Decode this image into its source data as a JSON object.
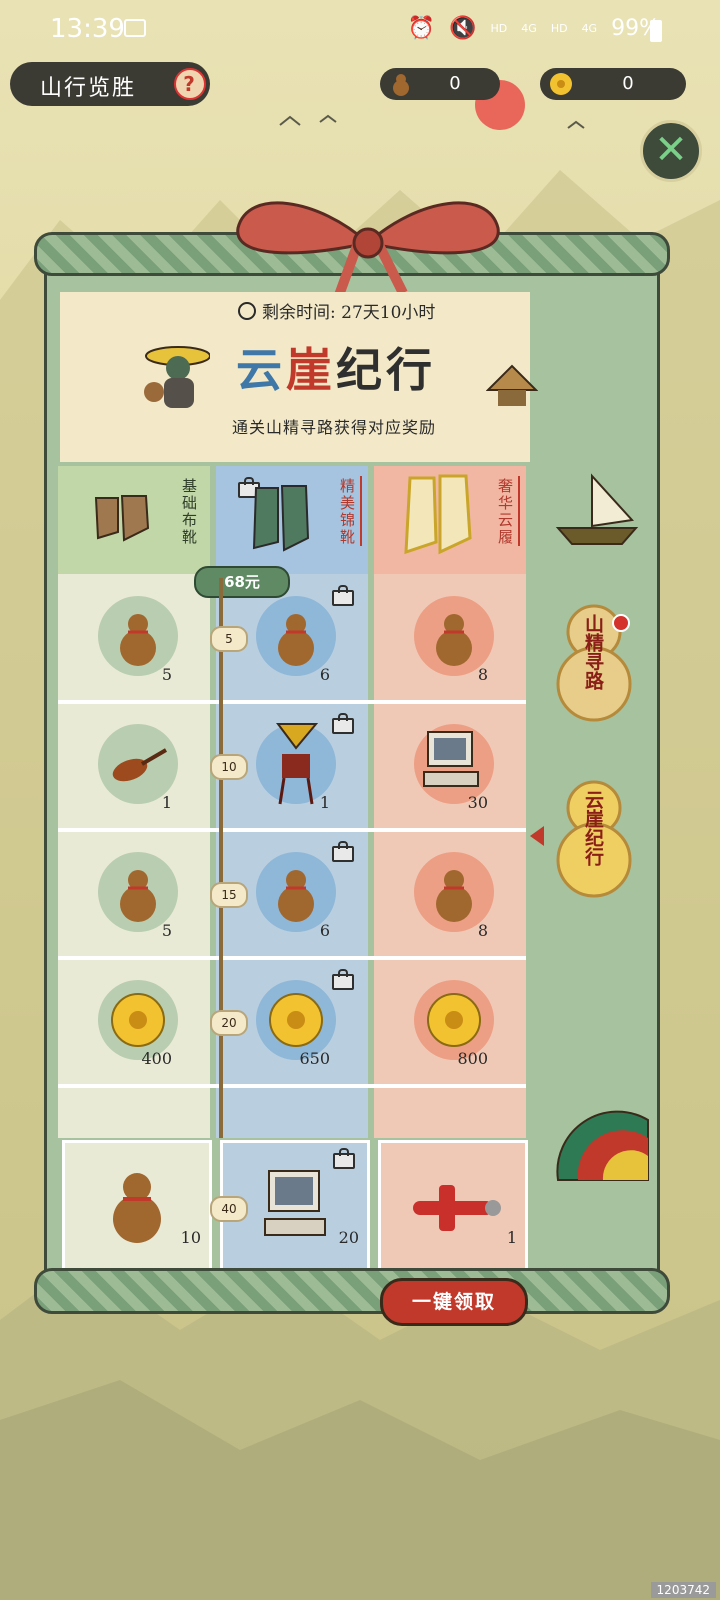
{
  "status_bar": {
    "time": "13:39",
    "hd1": "HD",
    "net1": "4G",
    "hd2": "HD",
    "net2": "4G",
    "battery": "99%"
  },
  "top_bar": {
    "title": "山行览胜",
    "help": "?",
    "gourd_count": "0",
    "flower_count": "0",
    "close": "✕"
  },
  "event": {
    "timer_label": "剩余时间: 27天10小时",
    "title_chars": [
      "云",
      "崖",
      "纪行"
    ],
    "subtitle": "通关山精寻路获得对应奖励"
  },
  "tiers": [
    {
      "name": "基础布靴"
    },
    {
      "name": "精美锦靴",
      "price": "68元"
    },
    {
      "name": "奢华云履"
    }
  ],
  "rows": [
    {
      "level": "5",
      "rewards": [
        {
          "icon": "gourd-icon",
          "qty": "5"
        },
        {
          "icon": "gourd-icon",
          "qty": "6"
        },
        {
          "icon": "gourd-icon",
          "qty": "8"
        }
      ]
    },
    {
      "level": "10",
      "rewards": [
        {
          "icon": "violin-icon",
          "qty": "1"
        },
        {
          "icon": "gramophone-icon",
          "qty": "1"
        },
        {
          "icon": "computer-icon",
          "qty": "30"
        }
      ]
    },
    {
      "level": "15",
      "rewards": [
        {
          "icon": "gourd-icon",
          "qty": "5"
        },
        {
          "icon": "gourd-icon",
          "qty": "6"
        },
        {
          "icon": "gourd-icon",
          "qty": "8"
        }
      ]
    },
    {
      "level": "20",
      "rewards": [
        {
          "icon": "flower-icon",
          "qty": "400"
        },
        {
          "icon": "flower-icon",
          "qty": "650"
        },
        {
          "icon": "flower-icon",
          "qty": "800"
        }
      ]
    }
  ],
  "final_row": {
    "level": "40",
    "rewards": [
      {
        "icon": "gourd-icon",
        "qty": "10"
      },
      {
        "icon": "computer-icon",
        "qty": "20"
      },
      {
        "icon": "airplane-icon",
        "qty": "1"
      }
    ]
  },
  "collect_button": "一键领取",
  "side_tabs": [
    {
      "label": "山精寻路"
    },
    {
      "label": "云崖纪行"
    }
  ],
  "watermark": "1203742",
  "colors": {
    "accent_red": "#c0392b",
    "accent_blue": "#3f78a8",
    "panel_green": "#a7c29e"
  }
}
